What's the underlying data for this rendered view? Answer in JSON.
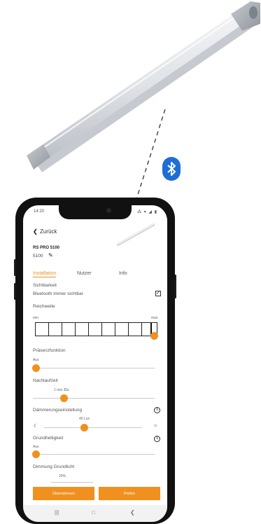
{
  "app": {
    "status_time": "14:20",
    "status_icons": "⁂ ▾ ◢ ▮",
    "back_label": "Zurück",
    "device_name": "RS PRO 5100",
    "device_id": "5100"
  },
  "tabs": [
    {
      "label": "Installation",
      "active": true
    },
    {
      "label": "Nutzer",
      "active": false
    },
    {
      "label": "Info",
      "active": false
    }
  ],
  "settings": {
    "visibility_label": "Sichtbarkeit",
    "bluetooth_label": "Bluetooth immer sichtbar",
    "bluetooth_checked": true,
    "range_label": "Reichweite",
    "range_min": "min",
    "range_max": "max",
    "range_level": 1.0,
    "presence_label": "Präsenzfunktion",
    "presence_value": "Aus",
    "presence_level": 0.0,
    "followup_label": "Nachlaufzeit",
    "followup_value": "1 min 30s",
    "followup_level": 0.25,
    "twilight_label": "Dämmerungseinstellung",
    "twilight_value": "40 Lux",
    "twilight_level": 0.42,
    "base_brightness_label": "Grundhelligkeit",
    "base_brightness_value": "Aus",
    "base_brightness_level": 0.0,
    "dimming_label": "Dimmung Grundlicht",
    "dimming_value": "20%"
  },
  "buttons": {
    "apply": "Übernehmen",
    "test": "Prüfen"
  },
  "colors": {
    "accent": "#f0911f",
    "bluetooth": "#1d6fd6"
  },
  "icons": {
    "bluetooth": "bluetooth-icon",
    "info": "info-icon",
    "moon": "moon-icon",
    "sun": "sun-icon",
    "edit": "pencil-icon"
  }
}
